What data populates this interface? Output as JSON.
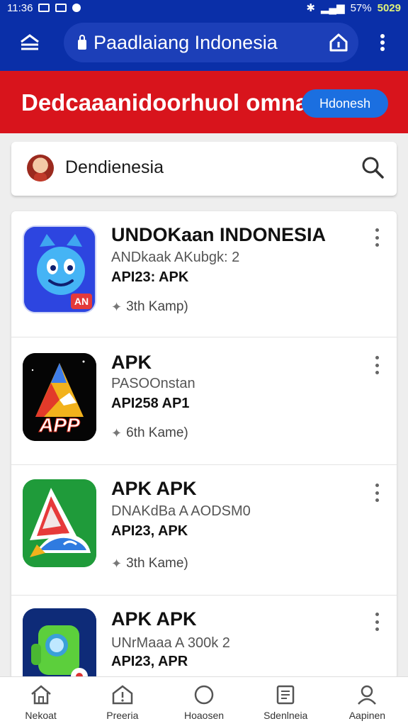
{
  "status_bar": {
    "time": "11:36",
    "battery": "57%",
    "right_time": "5029"
  },
  "browser": {
    "url": "Paadlaiang Indonesia"
  },
  "banner": {
    "title": "Dedcaaanidoorhuol omnai",
    "button_label": "Hdonesh"
  },
  "search": {
    "text": "Dendienesia"
  },
  "apps": [
    {
      "title": "UNDOKaan INDONESIA",
      "subtitle": "ANDkaak AKubgk: 2",
      "version": "API23: APK",
      "rating": "3th  Kamp)",
      "icon": "blue-cat-app-icon"
    },
    {
      "title": "APK",
      "subtitle": "PASOOnstan",
      "version": "API258 AP1",
      "rating": "6th  Kame)",
      "icon_text": "APP",
      "icon": "app-triangle-icon"
    },
    {
      "title": "APK APK",
      "subtitle": "DNAKdBa A AODSM0",
      "version": "API23, APK",
      "rating": "3th  Kame)",
      "icon": "green-triangle-app-icon"
    },
    {
      "title": "APK APK",
      "subtitle": "UNrMaaa A 300k 2",
      "version": "API23, APR",
      "rating": "",
      "icon": "green-robot-app-icon"
    }
  ],
  "bottom_nav": [
    {
      "label": "Nekoat",
      "icon": "home-icon"
    },
    {
      "label": "Preeria",
      "icon": "shield-home-icon"
    },
    {
      "label": "Hoaosen",
      "icon": "circle-icon"
    },
    {
      "label": "Sdenlneia",
      "icon": "document-icon"
    },
    {
      "label": "Aapinen",
      "icon": "person-icon"
    }
  ]
}
